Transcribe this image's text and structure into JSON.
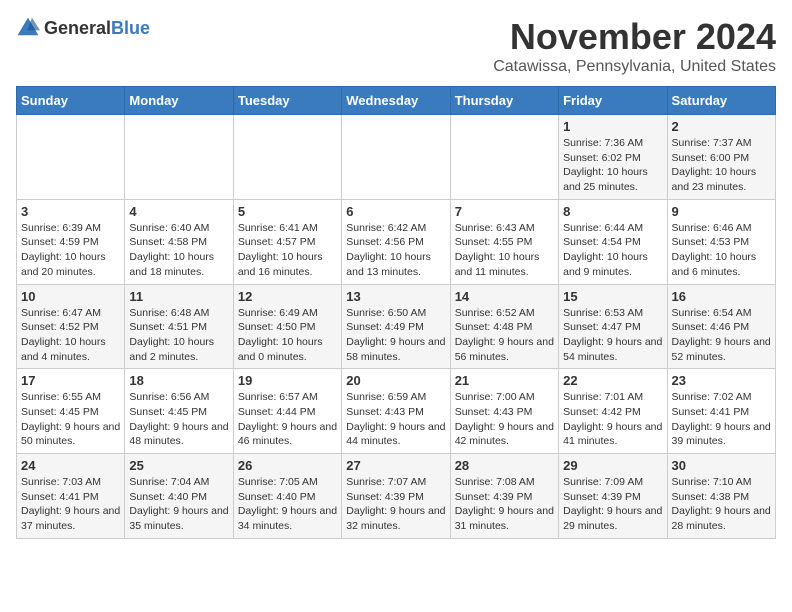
{
  "header": {
    "logo_general": "General",
    "logo_blue": "Blue",
    "month_title": "November 2024",
    "subtitle": "Catawissa, Pennsylvania, United States"
  },
  "days_of_week": [
    "Sunday",
    "Monday",
    "Tuesday",
    "Wednesday",
    "Thursday",
    "Friday",
    "Saturday"
  ],
  "weeks": [
    [
      {
        "day": "",
        "content": ""
      },
      {
        "day": "",
        "content": ""
      },
      {
        "day": "",
        "content": ""
      },
      {
        "day": "",
        "content": ""
      },
      {
        "day": "",
        "content": ""
      },
      {
        "day": "1",
        "content": "Sunrise: 7:36 AM\nSunset: 6:02 PM\nDaylight: 10 hours and 25 minutes."
      },
      {
        "day": "2",
        "content": "Sunrise: 7:37 AM\nSunset: 6:00 PM\nDaylight: 10 hours and 23 minutes."
      }
    ],
    [
      {
        "day": "3",
        "content": "Sunrise: 6:39 AM\nSunset: 4:59 PM\nDaylight: 10 hours and 20 minutes."
      },
      {
        "day": "4",
        "content": "Sunrise: 6:40 AM\nSunset: 4:58 PM\nDaylight: 10 hours and 18 minutes."
      },
      {
        "day": "5",
        "content": "Sunrise: 6:41 AM\nSunset: 4:57 PM\nDaylight: 10 hours and 16 minutes."
      },
      {
        "day": "6",
        "content": "Sunrise: 6:42 AM\nSunset: 4:56 PM\nDaylight: 10 hours and 13 minutes."
      },
      {
        "day": "7",
        "content": "Sunrise: 6:43 AM\nSunset: 4:55 PM\nDaylight: 10 hours and 11 minutes."
      },
      {
        "day": "8",
        "content": "Sunrise: 6:44 AM\nSunset: 4:54 PM\nDaylight: 10 hours and 9 minutes."
      },
      {
        "day": "9",
        "content": "Sunrise: 6:46 AM\nSunset: 4:53 PM\nDaylight: 10 hours and 6 minutes."
      }
    ],
    [
      {
        "day": "10",
        "content": "Sunrise: 6:47 AM\nSunset: 4:52 PM\nDaylight: 10 hours and 4 minutes."
      },
      {
        "day": "11",
        "content": "Sunrise: 6:48 AM\nSunset: 4:51 PM\nDaylight: 10 hours and 2 minutes."
      },
      {
        "day": "12",
        "content": "Sunrise: 6:49 AM\nSunset: 4:50 PM\nDaylight: 10 hours and 0 minutes."
      },
      {
        "day": "13",
        "content": "Sunrise: 6:50 AM\nSunset: 4:49 PM\nDaylight: 9 hours and 58 minutes."
      },
      {
        "day": "14",
        "content": "Sunrise: 6:52 AM\nSunset: 4:48 PM\nDaylight: 9 hours and 56 minutes."
      },
      {
        "day": "15",
        "content": "Sunrise: 6:53 AM\nSunset: 4:47 PM\nDaylight: 9 hours and 54 minutes."
      },
      {
        "day": "16",
        "content": "Sunrise: 6:54 AM\nSunset: 4:46 PM\nDaylight: 9 hours and 52 minutes."
      }
    ],
    [
      {
        "day": "17",
        "content": "Sunrise: 6:55 AM\nSunset: 4:45 PM\nDaylight: 9 hours and 50 minutes."
      },
      {
        "day": "18",
        "content": "Sunrise: 6:56 AM\nSunset: 4:45 PM\nDaylight: 9 hours and 48 minutes."
      },
      {
        "day": "19",
        "content": "Sunrise: 6:57 AM\nSunset: 4:44 PM\nDaylight: 9 hours and 46 minutes."
      },
      {
        "day": "20",
        "content": "Sunrise: 6:59 AM\nSunset: 4:43 PM\nDaylight: 9 hours and 44 minutes."
      },
      {
        "day": "21",
        "content": "Sunrise: 7:00 AM\nSunset: 4:43 PM\nDaylight: 9 hours and 42 minutes."
      },
      {
        "day": "22",
        "content": "Sunrise: 7:01 AM\nSunset: 4:42 PM\nDaylight: 9 hours and 41 minutes."
      },
      {
        "day": "23",
        "content": "Sunrise: 7:02 AM\nSunset: 4:41 PM\nDaylight: 9 hours and 39 minutes."
      }
    ],
    [
      {
        "day": "24",
        "content": "Sunrise: 7:03 AM\nSunset: 4:41 PM\nDaylight: 9 hours and 37 minutes."
      },
      {
        "day": "25",
        "content": "Sunrise: 7:04 AM\nSunset: 4:40 PM\nDaylight: 9 hours and 35 minutes."
      },
      {
        "day": "26",
        "content": "Sunrise: 7:05 AM\nSunset: 4:40 PM\nDaylight: 9 hours and 34 minutes."
      },
      {
        "day": "27",
        "content": "Sunrise: 7:07 AM\nSunset: 4:39 PM\nDaylight: 9 hours and 32 minutes."
      },
      {
        "day": "28",
        "content": "Sunrise: 7:08 AM\nSunset: 4:39 PM\nDaylight: 9 hours and 31 minutes."
      },
      {
        "day": "29",
        "content": "Sunrise: 7:09 AM\nSunset: 4:39 PM\nDaylight: 9 hours and 29 minutes."
      },
      {
        "day": "30",
        "content": "Sunrise: 7:10 AM\nSunset: 4:38 PM\nDaylight: 9 hours and 28 minutes."
      }
    ]
  ]
}
